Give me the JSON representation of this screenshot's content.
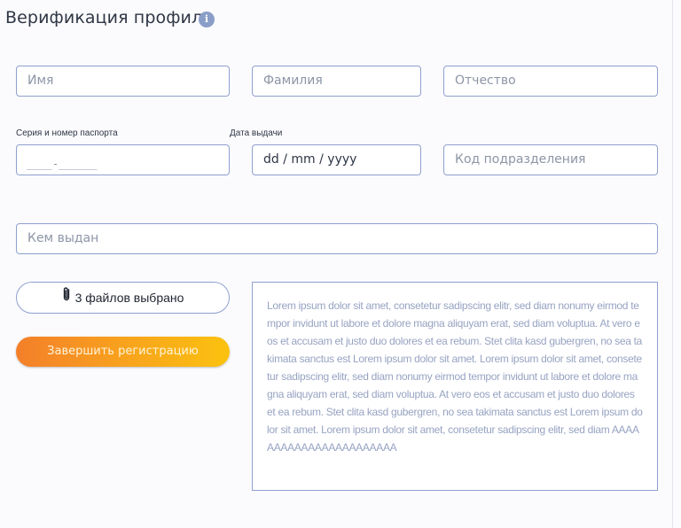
{
  "header": {
    "title": "Верификация профиля",
    "info_icon": "i"
  },
  "form": {
    "first_name": {
      "placeholder": "Имя"
    },
    "last_name": {
      "placeholder": "Фамилия"
    },
    "middle_name": {
      "placeholder": "Отчество"
    },
    "passport": {
      "label": "Серия и номер паспорта",
      "mask": "____-______"
    },
    "issue_date": {
      "label": "Дата выдачи",
      "value": "dd / mm / yyyy"
    },
    "division_code": {
      "placeholder": "Код подразделения"
    },
    "issued_by": {
      "placeholder": "Кем выдан"
    },
    "files_button": {
      "label": "3 файлов выбрано",
      "icon": "paperclip-icon"
    },
    "submit_button": {
      "label": "Завершить регистрацию"
    },
    "text_box": "Lorem ipsum dolor sit amet, consetetur sadipscing elitr, sed diam nonumy eirmod tempor invidunt ut labore et dolore magna aliquyam erat, sed diam voluptua. At vero eos et accusam et justo duo dolores et ea rebum. Stet clita kasd gubergren, no sea takimata sanctus est Lorem ipsum dolor sit amet. Lorem ipsum dolor sit amet, consetetur sadipscing elitr, sed diam nonumy eirmod tempor invidunt ut labore et dolore magna aliquyam erat, sed diam voluptua. At vero eos et accusam et justo duo dolores et ea rebum. Stet clita kasd gubergren, no sea takimata sanctus est Lorem ipsum dolor sit amet. Lorem ipsum dolor sit amet, consetetur sadipscing elitr, sed diam AAAAAAAAAAAAAAAAAAAAAAA"
  },
  "colors": {
    "border": "#8fa0cf",
    "title": "#2e3645",
    "accent_start": "#f47f2a",
    "accent_end": "#fbc20f",
    "info_icon": "#8a9ec8"
  }
}
